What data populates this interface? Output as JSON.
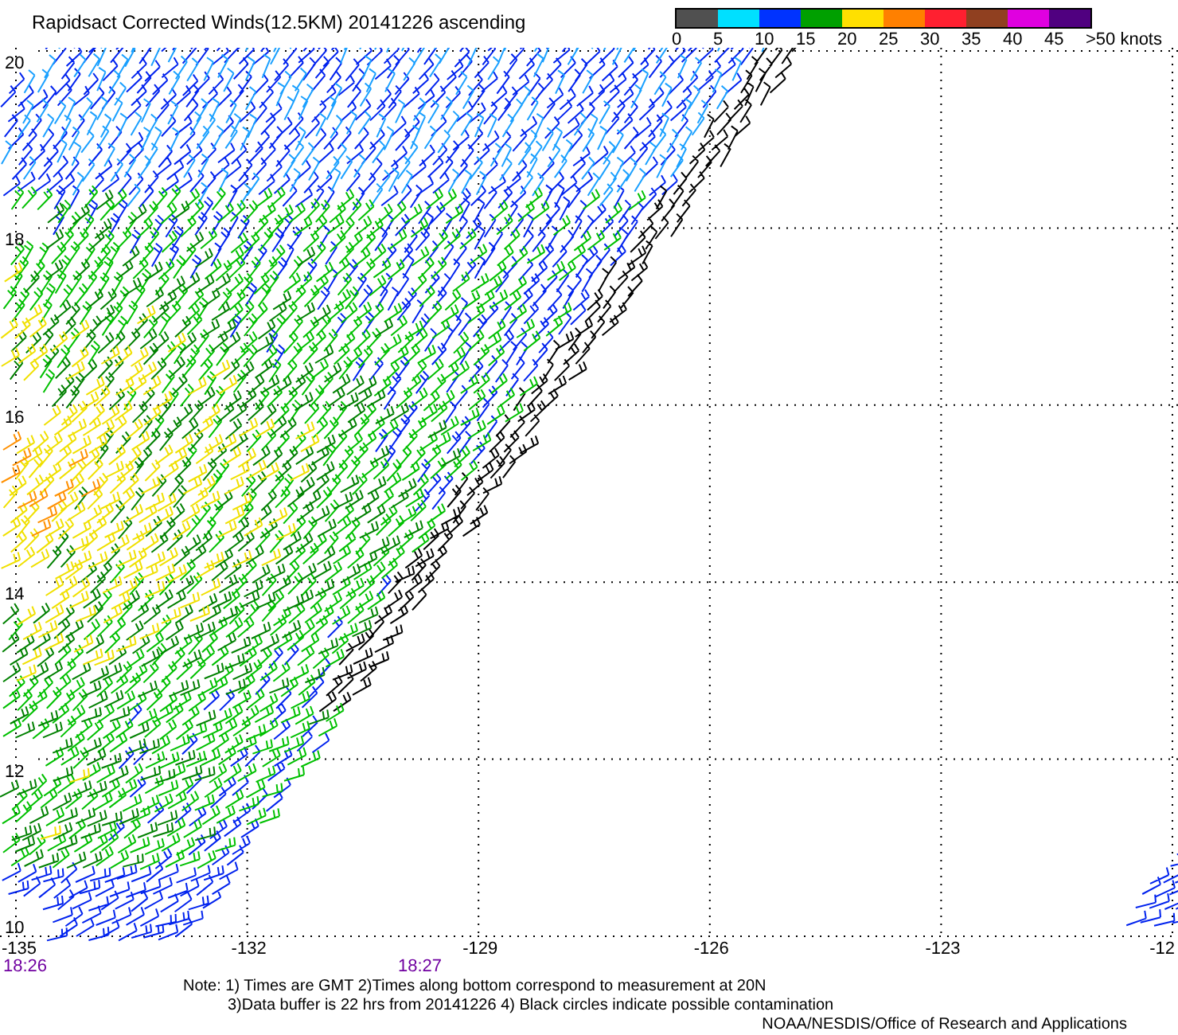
{
  "title": "Rapidsact Corrected Winds(12.5KM) 20141226 ascending",
  "legend": {
    "segments": [
      {
        "color": "#505050"
      },
      {
        "color": "#00e0ff"
      },
      {
        "color": "#0033ff"
      },
      {
        "color": "#00a000"
      },
      {
        "color": "#ffe000"
      },
      {
        "color": "#ff8000"
      },
      {
        "color": "#ff2030"
      },
      {
        "color": "#904020"
      },
      {
        "color": "#e000e0"
      },
      {
        "color": "#500080"
      }
    ],
    "labels": [
      "0",
      "5",
      "10",
      "15",
      "20",
      "25",
      "30",
      "35",
      "40",
      "45",
      ">50 knots"
    ]
  },
  "map": {
    "lat_labels": [
      "20",
      "18",
      "16",
      "14",
      "12",
      "10"
    ],
    "lon_labels": [
      "-135",
      "-132",
      "-129",
      "-126",
      "-123",
      "-12"
    ],
    "time_labels": [
      "18:26",
      "18:27"
    ]
  },
  "notes": [
    "Note: 1) Times are GMT 2)Times along bottom correspond to measurement at 20N",
    "3)Data buffer is 22 hrs from 20141226 4) Black circles indicate possible contamination"
  ],
  "credit": "NOAA/NESDIS/Office of Research and Applications"
}
